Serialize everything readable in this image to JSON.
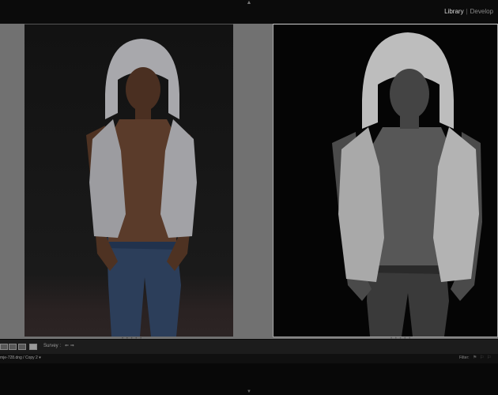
{
  "header": {
    "modules": [
      {
        "label": "Library",
        "active": true
      },
      {
        "label": "Develop",
        "active": false
      }
    ],
    "separator": "|",
    "top_panel_arrow": "▲"
  },
  "photos": {
    "left": {
      "variant": "color"
    },
    "right": {
      "variant": "black-and-white"
    }
  },
  "workarea": {
    "scroll_dots": "• • • • •"
  },
  "toolbar": {
    "survey_label": "Survey :",
    "nav_arrows": "⇐ ⇒",
    "view_buttons": [
      "grid-view-icon",
      "loupe-view-icon",
      "compare-view-icon",
      "survey-view-icon"
    ]
  },
  "filmstrip": {
    "filename": "mje-728.dng / Copy 2 ▾",
    "filter_label": "Filter:",
    "flags": "⚑ ⚐ ⚐"
  },
  "footer": {
    "bottom_panel_arrow": "▼"
  },
  "colors": {
    "background": "#717171",
    "top_bar": "#0b0b0b",
    "toolbar": "#1c1c1c"
  }
}
